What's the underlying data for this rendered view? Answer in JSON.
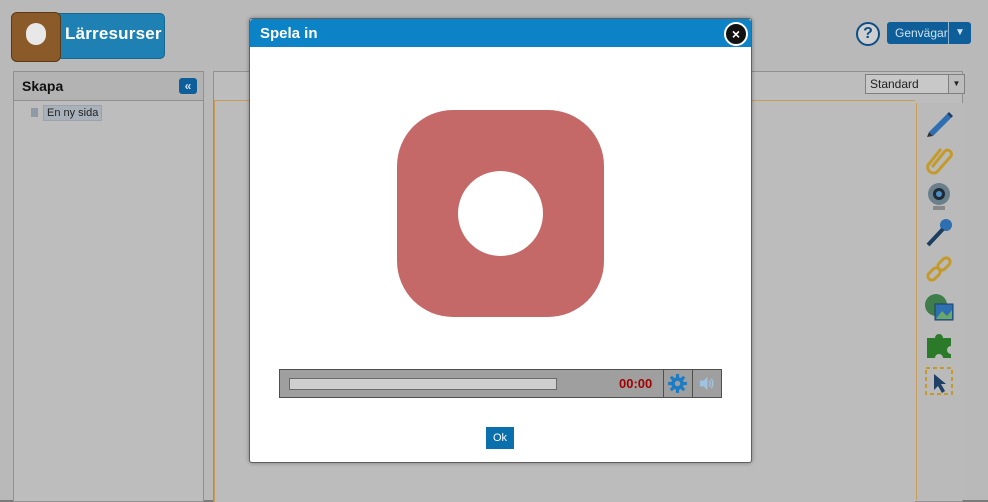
{
  "app": {
    "logo_text": "Lärresurser",
    "shortcuts_label": "Genvägar",
    "left_panel": {
      "title": "Skapa",
      "items": [
        {
          "label": "En ny sida"
        }
      ]
    },
    "view_select": {
      "selected": "Standard"
    },
    "toolbar_icons": [
      "pencil-icon",
      "paperclip-icon",
      "webcam-icon",
      "microphone-icon",
      "link-icon",
      "image-icon",
      "puzzle-icon",
      "selection-icon"
    ]
  },
  "dialog": {
    "title": "Spela in",
    "player": {
      "time": "00:00",
      "progress": 0
    },
    "ok_label": "Ok"
  },
  "colors": {
    "header_blue": "#0d83c7",
    "record_red": "#c46868",
    "time_red": "#a30000",
    "ok_button": "#0a6fad"
  }
}
